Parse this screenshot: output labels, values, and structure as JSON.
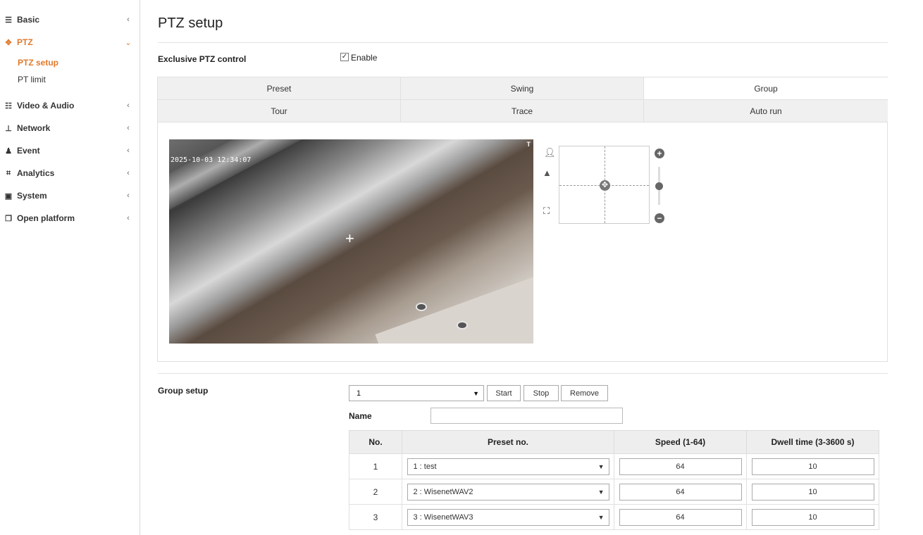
{
  "sidebar": {
    "items": [
      {
        "icon": "list-icon",
        "label": "Basic",
        "chevron": "‹"
      },
      {
        "icon": "ptz-move-icon",
        "label": "PTZ",
        "chevron": "⌄"
      },
      {
        "icon": "sliders-icon",
        "label": "Video & Audio",
        "chevron": "‹"
      },
      {
        "icon": "network-icon",
        "label": "Network",
        "chevron": "‹"
      },
      {
        "icon": "bell-icon",
        "label": "Event",
        "chevron": "‹"
      },
      {
        "icon": "analytics-icon",
        "label": "Analytics",
        "chevron": "‹"
      },
      {
        "icon": "system-icon",
        "label": "System",
        "chevron": "‹"
      },
      {
        "icon": "open-platform-icon",
        "label": "Open platform",
        "chevron": "‹"
      }
    ],
    "subitems": [
      {
        "label": "PTZ setup"
      },
      {
        "label": "PT limit"
      }
    ],
    "accent_color": "#e07a2c"
  },
  "page": {
    "title": "PTZ setup"
  },
  "exclusive": {
    "label": "Exclusive PTZ control",
    "check": "✓",
    "enable_label": "Enable"
  },
  "tabs": [
    "Preset",
    "Swing",
    "Group",
    "Tour",
    "Trace",
    "Auto run"
  ],
  "active_tab": "Group",
  "video": {
    "timestamp": "2025-10-03 12:34:07",
    "corner_mark": "T"
  },
  "group_setup": {
    "label": "Group setup",
    "selected_group": "1",
    "start_label": "Start",
    "stop_label": "Stop",
    "remove_label": "Remove",
    "name_label": "Name",
    "name_value": ""
  },
  "table": {
    "headers": [
      "No.",
      "Preset no.",
      "Speed (1-64)",
      "Dwell time (3-3600 s)"
    ],
    "rows": [
      {
        "no": "1",
        "preset": "1 : test",
        "speed": "64",
        "dwell": "10"
      },
      {
        "no": "2",
        "preset": "2 : WisenetWAV2",
        "speed": "64",
        "dwell": "10"
      },
      {
        "no": "3",
        "preset": "3 : WisenetWAV3",
        "speed": "64",
        "dwell": "10"
      }
    ]
  }
}
